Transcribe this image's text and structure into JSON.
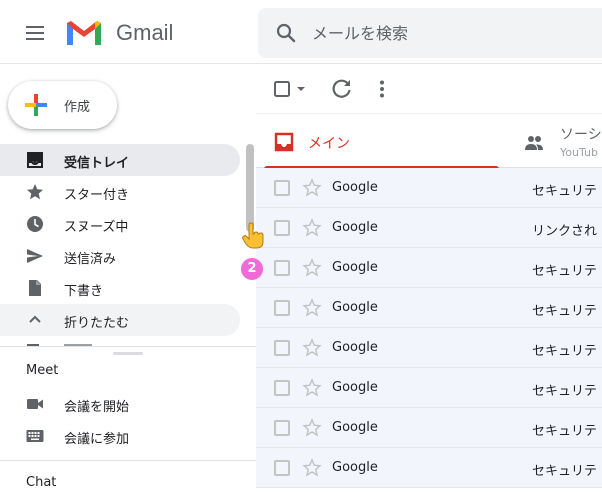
{
  "header": {
    "brand": "Gmail",
    "search_placeholder": "メールを検索"
  },
  "compose": {
    "label": "作成"
  },
  "nav": {
    "items": [
      {
        "label": "受信トレイ",
        "icon": "inbox-icon",
        "active": true
      },
      {
        "label": "スター付き",
        "icon": "star-icon"
      },
      {
        "label": "スヌーズ中",
        "icon": "clock-icon"
      },
      {
        "label": "送信済み",
        "icon": "send-icon"
      },
      {
        "label": "下書き",
        "icon": "draft-icon"
      },
      {
        "label": "折りたたむ",
        "icon": "chevron-up-icon"
      }
    ]
  },
  "meet": {
    "title": "Meet",
    "items": [
      {
        "label": "会議を開始",
        "icon": "videocam-icon"
      },
      {
        "label": "会議に参加",
        "icon": "keyboard-icon"
      }
    ]
  },
  "chat": {
    "title": "Chat"
  },
  "tabs": {
    "primary": {
      "label": "メイン"
    },
    "social": {
      "label": "ソーシ",
      "sub": "YouTub"
    }
  },
  "emails": [
    {
      "sender": "Google",
      "subject": "セキュリテ"
    },
    {
      "sender": "Google",
      "subject": "リンクされ"
    },
    {
      "sender": "Google",
      "subject": "セキュリテ"
    },
    {
      "sender": "Google",
      "subject": "セキュリテ"
    },
    {
      "sender": "Google",
      "subject": "セキュリテ"
    },
    {
      "sender": "Google",
      "subject": "セキュリテ"
    },
    {
      "sender": "Google",
      "subject": "セキュリテ"
    },
    {
      "sender": "Google",
      "subject": "セキュリテ"
    }
  ],
  "annotation": {
    "step": "2"
  },
  "colors": {
    "accent_red": "#d93025",
    "active_nav_bg": "#e8eaed",
    "row_bg": "#f2f6fc",
    "marker": "#f06bd8"
  }
}
